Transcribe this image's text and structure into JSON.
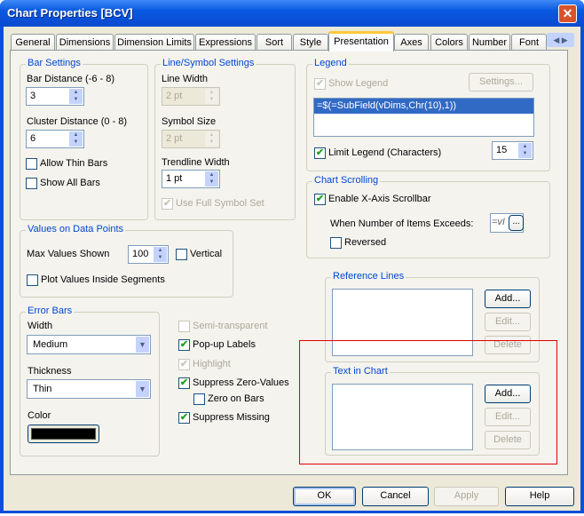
{
  "window": {
    "title": "Chart Properties [BCV]"
  },
  "tabs": [
    "General",
    "Dimensions",
    "Dimension Limits",
    "Expressions",
    "Sort",
    "Style",
    "Presentation",
    "Axes",
    "Colors",
    "Number",
    "Font"
  ],
  "active_tab": "Presentation",
  "bar_settings": {
    "title": "Bar Settings",
    "bar_distance_label": "Bar Distance (-6 - 8)",
    "bar_distance": "3",
    "cluster_distance_label": "Cluster Distance (0 - 8)",
    "cluster_distance": "6",
    "allow_thin_bars": "Allow Thin Bars",
    "show_all_bars": "Show All Bars"
  },
  "line_symbol": {
    "title": "Line/Symbol Settings",
    "line_width_label": "Line Width",
    "line_width": "2 pt",
    "symbol_size_label": "Symbol Size",
    "symbol_size": "2 pt",
    "trendline_width_label": "Trendline Width",
    "trendline_width": "1 pt",
    "use_full_symbol_set": "Use Full Symbol Set"
  },
  "values_on_data_points": {
    "title": "Values on Data Points",
    "max_values_label": "Max Values Shown",
    "max_values": "100",
    "vertical": "Vertical",
    "plot_inside": "Plot Values Inside Segments"
  },
  "error_bars": {
    "title": "Error Bars",
    "width_label": "Width",
    "width": "Medium",
    "thickness_label": "Thickness",
    "thickness": "Thin",
    "color_label": "Color",
    "color": "#000000"
  },
  "options": {
    "semi_transparent": "Semi-transparent",
    "popup_labels": "Pop-up Labels",
    "highlight": "Highlight",
    "suppress_zero": "Suppress Zero-Values",
    "zero_on_bars": "Zero on Bars",
    "suppress_missing": "Suppress Missing"
  },
  "legend": {
    "title": "Legend",
    "show_legend": "Show Legend",
    "settings": "Settings...",
    "expression": "=$(=SubField(vDims,Chr(10),1))",
    "limit_legend": "Limit Legend (Characters)",
    "limit_value": "15"
  },
  "chart_scrolling": {
    "title": "Chart Scrolling",
    "enable_scrollbar": "Enable X-Axis Scrollbar",
    "when_exceeds": "When Number of Items Exceeds:",
    "exceeds_value": "=vI",
    "ellipsis": "...",
    "reversed": "Reversed"
  },
  "reference_lines": {
    "title": "Reference Lines",
    "add": "Add...",
    "edit": "Edit...",
    "delete": "Delete"
  },
  "text_in_chart": {
    "title": "Text in Chart",
    "add": "Add...",
    "edit": "Edit...",
    "delete": "Delete"
  },
  "footer": {
    "ok": "OK",
    "cancel": "Cancel",
    "apply": "Apply",
    "help": "Help"
  },
  "check": "✔",
  "highlight_color": "#e00000"
}
